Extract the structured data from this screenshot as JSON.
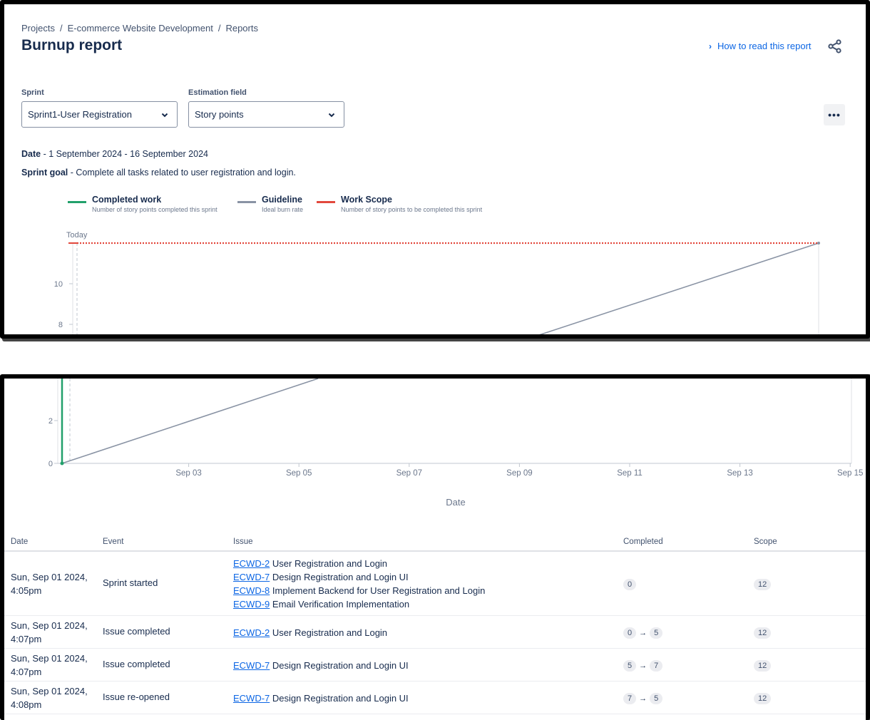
{
  "breadcrumb": [
    "Projects",
    "E-commerce Website Development",
    "Reports"
  ],
  "title": "Burnup report",
  "help_link": "How to read this report",
  "filters": {
    "sprint_label": "Sprint",
    "sprint_value": "Sprint1-User Registration",
    "estimation_label": "Estimation field",
    "estimation_value": "Story points"
  },
  "more_label": "•••",
  "date_label": "Date",
  "date_value": "- 1 September 2024 - 16 September 2024",
  "goal_label": "Sprint goal",
  "goal_value": "- Complete all tasks related to user registration and login.",
  "legend": [
    {
      "title": "Completed work",
      "desc": "Number of story points completed this sprint",
      "color": "#22a06b"
    },
    {
      "title": "Guideline",
      "desc": "Ideal burn rate",
      "color": "#8993a4"
    },
    {
      "title": "Work Scope",
      "desc": "Number of story points to be completed this sprint",
      "color": "#e2483d"
    }
  ],
  "today_label": "Today",
  "chart_data": {
    "type": "line",
    "xlabel": "Date",
    "ylabel": "",
    "x_ticks": [
      "Sep 03",
      "Sep 05",
      "Sep 07",
      "Sep 09",
      "Sep 11",
      "Sep 13",
      "Sep 15"
    ],
    "y_ticks_top": [
      10,
      8
    ],
    "y_ticks_bottom": [
      2,
      0
    ],
    "ylim": [
      0,
      12
    ],
    "x_range": [
      "2024-09-01",
      "2024-09-16"
    ],
    "series": [
      {
        "name": "Completed work",
        "color": "#22a06b",
        "points": [
          [
            "2024-09-01",
            0
          ],
          [
            "2024-09-01",
            5
          ],
          [
            "2024-09-01",
            7
          ],
          [
            "2024-09-01",
            5
          ]
        ]
      },
      {
        "name": "Guideline",
        "color": "#8993a4",
        "points": [
          [
            "2024-09-01",
            0
          ],
          [
            "2024-09-16",
            12
          ]
        ]
      },
      {
        "name": "Work Scope",
        "color": "#e2483d",
        "points": [
          [
            "2024-09-01",
            12
          ],
          [
            "2024-09-16",
            12
          ]
        ]
      }
    ]
  },
  "table": {
    "headers": [
      "Date",
      "Event",
      "Issue",
      "Completed",
      "Scope"
    ],
    "rows": [
      {
        "date1": "Sun, Sep 01 2024,",
        "date2": "4:05pm",
        "event": "Sprint started",
        "issues": [
          {
            "key": "ECWD-2",
            "title": "User Registration and Login"
          },
          {
            "key": "ECWD-7",
            "title": "Design Registration and Login UI"
          },
          {
            "key": "ECWD-8",
            "title": "Implement Backend for User Registration and Login"
          },
          {
            "key": "ECWD-9",
            "title": "Email Verification Implementation"
          }
        ],
        "completed_from": "0",
        "completed_to": "",
        "scope": "12"
      },
      {
        "date1": "Sun, Sep 01 2024,",
        "date2": "4:07pm",
        "event": "Issue completed",
        "issues": [
          {
            "key": "ECWD-2",
            "title": "User Registration and Login"
          }
        ],
        "completed_from": "0",
        "completed_to": "5",
        "scope": "12"
      },
      {
        "date1": "Sun, Sep 01 2024,",
        "date2": "4:07pm",
        "event": "Issue completed",
        "issues": [
          {
            "key": "ECWD-7",
            "title": "Design Registration and Login UI"
          }
        ],
        "completed_from": "5",
        "completed_to": "7",
        "scope": "12"
      },
      {
        "date1": "Sun, Sep 01 2024,",
        "date2": "4:08pm",
        "event": "Issue re-opened",
        "issues": [
          {
            "key": "ECWD-7",
            "title": "Design Registration and Login UI"
          }
        ],
        "completed_from": "7",
        "completed_to": "5",
        "scope": "12"
      }
    ]
  }
}
